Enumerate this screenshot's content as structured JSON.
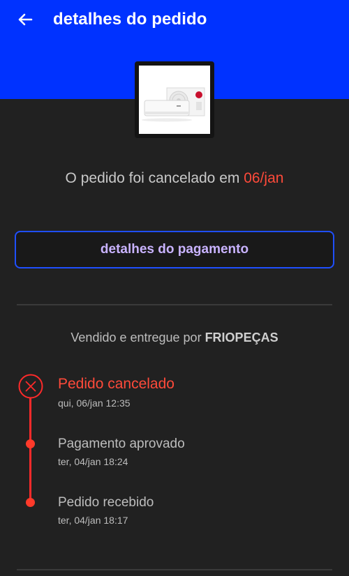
{
  "header": {
    "title": "detalhes do pedido",
    "back_icon": "arrow-left-icon",
    "color": "#0032ff"
  },
  "order": {
    "status_text": "O pedido foi cancelado em ",
    "status_date": "06/jan",
    "payment_button_label": "detalhes do pagamento",
    "seller_prefix": "Vendido e entregue por ",
    "seller_name": "FRIOPEÇAS"
  },
  "timeline": [
    {
      "title": "Pedido cancelado",
      "time": "qui, 06/jan 12:35",
      "icon": "close-circle-icon",
      "active": true
    },
    {
      "title": "Pagamento aprovado",
      "time": "ter, 04/jan 18:24",
      "icon": "dot-icon",
      "active": false
    },
    {
      "title": "Pedido recebido",
      "time": "ter, 04/jan 18:17",
      "icon": "dot-icon",
      "active": false
    }
  ],
  "colors": {
    "accent_red": "#ff4a3a",
    "button_border": "#1f4fff",
    "button_text": "#c9b3ff",
    "background": "#212121"
  }
}
